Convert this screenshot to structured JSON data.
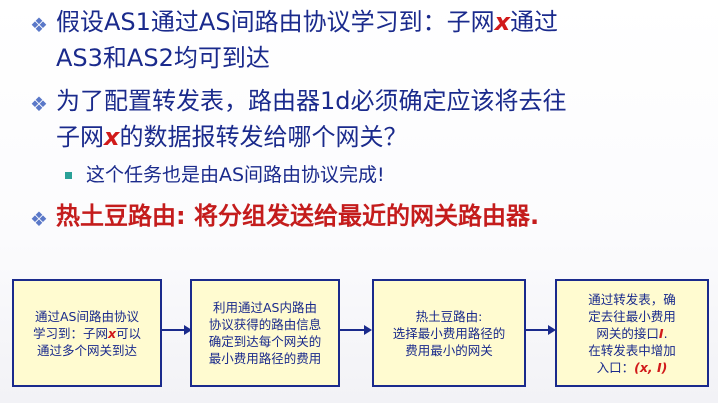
{
  "bullets": [
    {
      "line1_a": "假设AS1通过AS间路由协议学习到：子网",
      "line1_x": "x",
      "line1_b": "通过",
      "line2": "AS3和AS2均可到达"
    },
    {
      "line1": "为了配置转发表，路由器1d必须确定应该将去往",
      "line2_a": "子网",
      "line2_x": "x",
      "line2_b": "的数据报转发给哪个网关？"
    }
  ],
  "sub_bullet": "这个任务也是由AS间路由协议完成!",
  "hot_potato": {
    "label": "热土豆路由:",
    "text": " 将分组发送给最近的网关路由器."
  },
  "boxes": [
    {
      "l1": "通过AS间路由协议",
      "l2a": "学习到：子网",
      "l2x": "x",
      "l2b": "可以",
      "l3": "通过多个网关到达"
    },
    {
      "l1": "利用通过AS内路由",
      "l2": "协议获得的路由信息",
      "l3": "确定到达每个网关的",
      "l4": "最小费用路径的费用"
    },
    {
      "l1": "热土豆路由:",
      "l2": "选择最小费用路径的",
      "l3": "费用最小的网关"
    },
    {
      "l1": "通过转发表，确",
      "l2a": "定去往最小费用",
      "l3a": "网关的接口",
      "l3i": "I",
      "l3b": ".",
      "l4": "在转发表中增加",
      "l5a": "入口：",
      "l5b": "(x, I)"
    }
  ]
}
